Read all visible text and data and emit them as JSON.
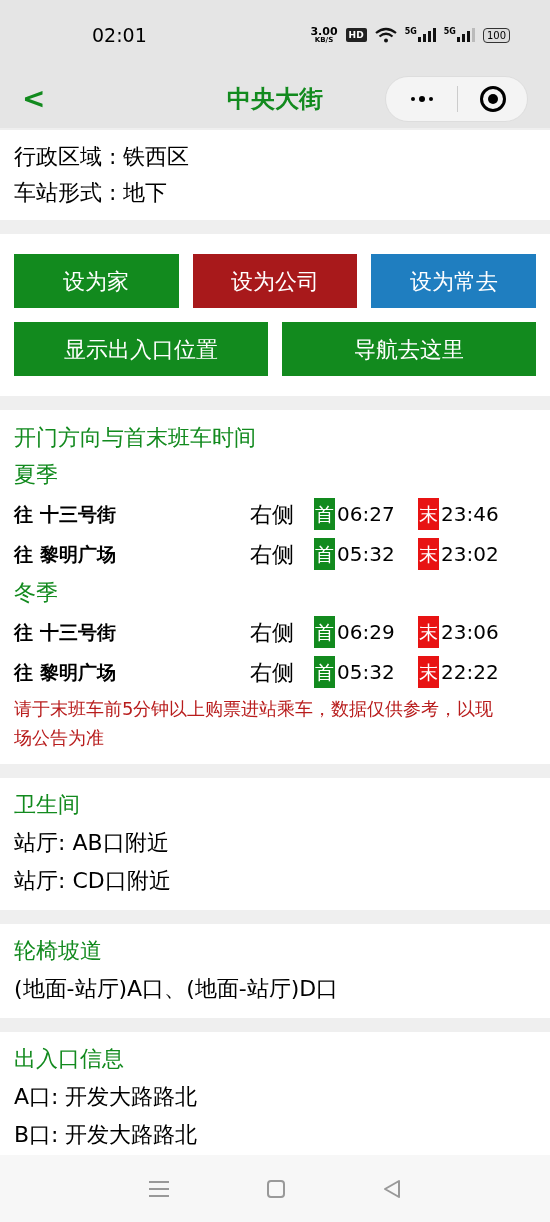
{
  "status_bar": {
    "time": "02:01",
    "speed_value": "3.00",
    "speed_unit": "KB/S",
    "hd_label": "HD",
    "sim_labels": [
      "5G",
      "5G"
    ],
    "battery": "100"
  },
  "header": {
    "back": "<",
    "title": "中央大街"
  },
  "info": [
    "行政区域 : 铁西区",
    "车站形式 : 地下"
  ],
  "buttons": [
    [
      {
        "label": "设为家",
        "color": "#128a1e"
      },
      {
        "label": "设为公司",
        "color": "#a8191b"
      },
      {
        "label": "设为常去",
        "color": "#1f7ec0"
      }
    ],
    [
      {
        "label": "显示出入口位置",
        "color": "#128a1e"
      },
      {
        "label": "导航去这里",
        "color": "#128a1e"
      }
    ]
  ],
  "timetable": {
    "title": "开门方向与首末班车时间",
    "seasons": [
      {
        "name": "夏季",
        "rows": [
          {
            "direction": "往 十三号街",
            "side": "右侧",
            "first_badge": "首",
            "first": "06:27",
            "last_badge": "末",
            "last": "23:46"
          },
          {
            "direction": "往 黎明广场",
            "side": "右侧",
            "first_badge": "首",
            "first": "05:32",
            "last_badge": "末",
            "last": "23:02"
          }
        ]
      },
      {
        "name": "冬季",
        "rows": [
          {
            "direction": "往 十三号街",
            "side": "右侧",
            "first_badge": "首",
            "first": "06:29",
            "last_badge": "末",
            "last": "23:06"
          },
          {
            "direction": "往 黎明广场",
            "side": "右侧",
            "first_badge": "首",
            "first": "05:32",
            "last_badge": "末",
            "last": "22:22"
          }
        ]
      }
    ],
    "notice": "请于末班车前5分钟以上购票进站乘车，数据仅供参考，以现场公告为准"
  },
  "sections": [
    {
      "title": "卫生间",
      "lines": [
        "站厅: AB口附近",
        "站厅: CD口附近"
      ]
    },
    {
      "title": "轮椅坡道",
      "lines": [
        "(地面-站厅)A口、(地面-站厅)D口"
      ]
    },
    {
      "title": "出入口信息",
      "lines": [
        "A口: 开发大路路北",
        "B口: 开发大路路北"
      ]
    }
  ]
}
